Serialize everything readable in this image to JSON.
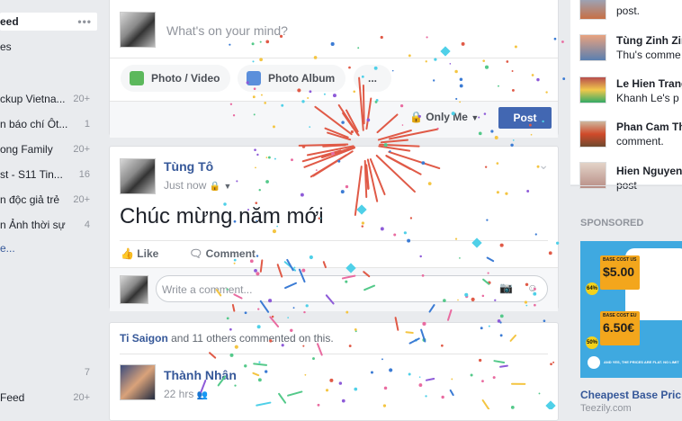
{
  "left_nav": {
    "items": [
      {
        "label": "eed",
        "count": "",
        "active": true
      },
      {
        "label": "es",
        "count": ""
      },
      {
        "label": "ckup Vietna...",
        "count": "20+"
      },
      {
        "label": "n báo chí Ôt...",
        "count": "1"
      },
      {
        "label": "ong Family",
        "count": "20+"
      },
      {
        "label": "st - S11 Tin...",
        "count": "16"
      },
      {
        "label": "n độc giả trẻ",
        "count": "20+"
      },
      {
        "label": "n Ảnh thời sự",
        "count": "4"
      },
      {
        "label": "e...",
        "count": ""
      },
      {
        "label": "",
        "count": "7"
      },
      {
        "label": "Feed",
        "count": "20+"
      }
    ]
  },
  "composer": {
    "placeholder": "What's on your mind?",
    "photo_video": "Photo / Video",
    "photo_album": "Photo Album",
    "more": "...",
    "privacy": "Only Me",
    "post": "Post"
  },
  "post1": {
    "author": "Tùng Tô",
    "time": "Just now",
    "text": "Chúc mừng năm mới",
    "like": "Like",
    "comment": "Comment",
    "comment_placeholder": "Write a comment..."
  },
  "post2": {
    "activity_name": "Ti Saigon",
    "activity_rest": " and 11 others commented on this.",
    "author": "Thành Nhân",
    "time": "22 hrs"
  },
  "right": {
    "contacts": [
      {
        "name": "",
        "sub": "post."
      },
      {
        "name": "Tùng Zinh Zin",
        "sub": "Thu's comme"
      },
      {
        "name": "Le Hien Trang",
        "sub": "Khanh Le's p"
      },
      {
        "name": "Phan Cam Th",
        "sub": "comment."
      },
      {
        "name": "Hien Nguyen",
        "sub": "post"
      }
    ],
    "sponsored": "SPONSORED",
    "ad": {
      "us_label": "BASE COST US",
      "us_price": "$5.00",
      "eu_label": "BASE COST EU",
      "eu_price": "6.50€",
      "tag1": "64%",
      "tag2": "50%",
      "footer": "AND YES, THE PRICES ARE FLAT. NO LIMIT",
      "title": "Cheapest Base Pric",
      "domain": "Teezily.com"
    }
  },
  "colors": {
    "accent": "#4267b2",
    "link": "#365899",
    "confetti": [
      "#e05a47",
      "#f4c542",
      "#4fd0e8",
      "#3b7bd4",
      "#8e5bd8",
      "#54c98a",
      "#e96ba0"
    ]
  }
}
